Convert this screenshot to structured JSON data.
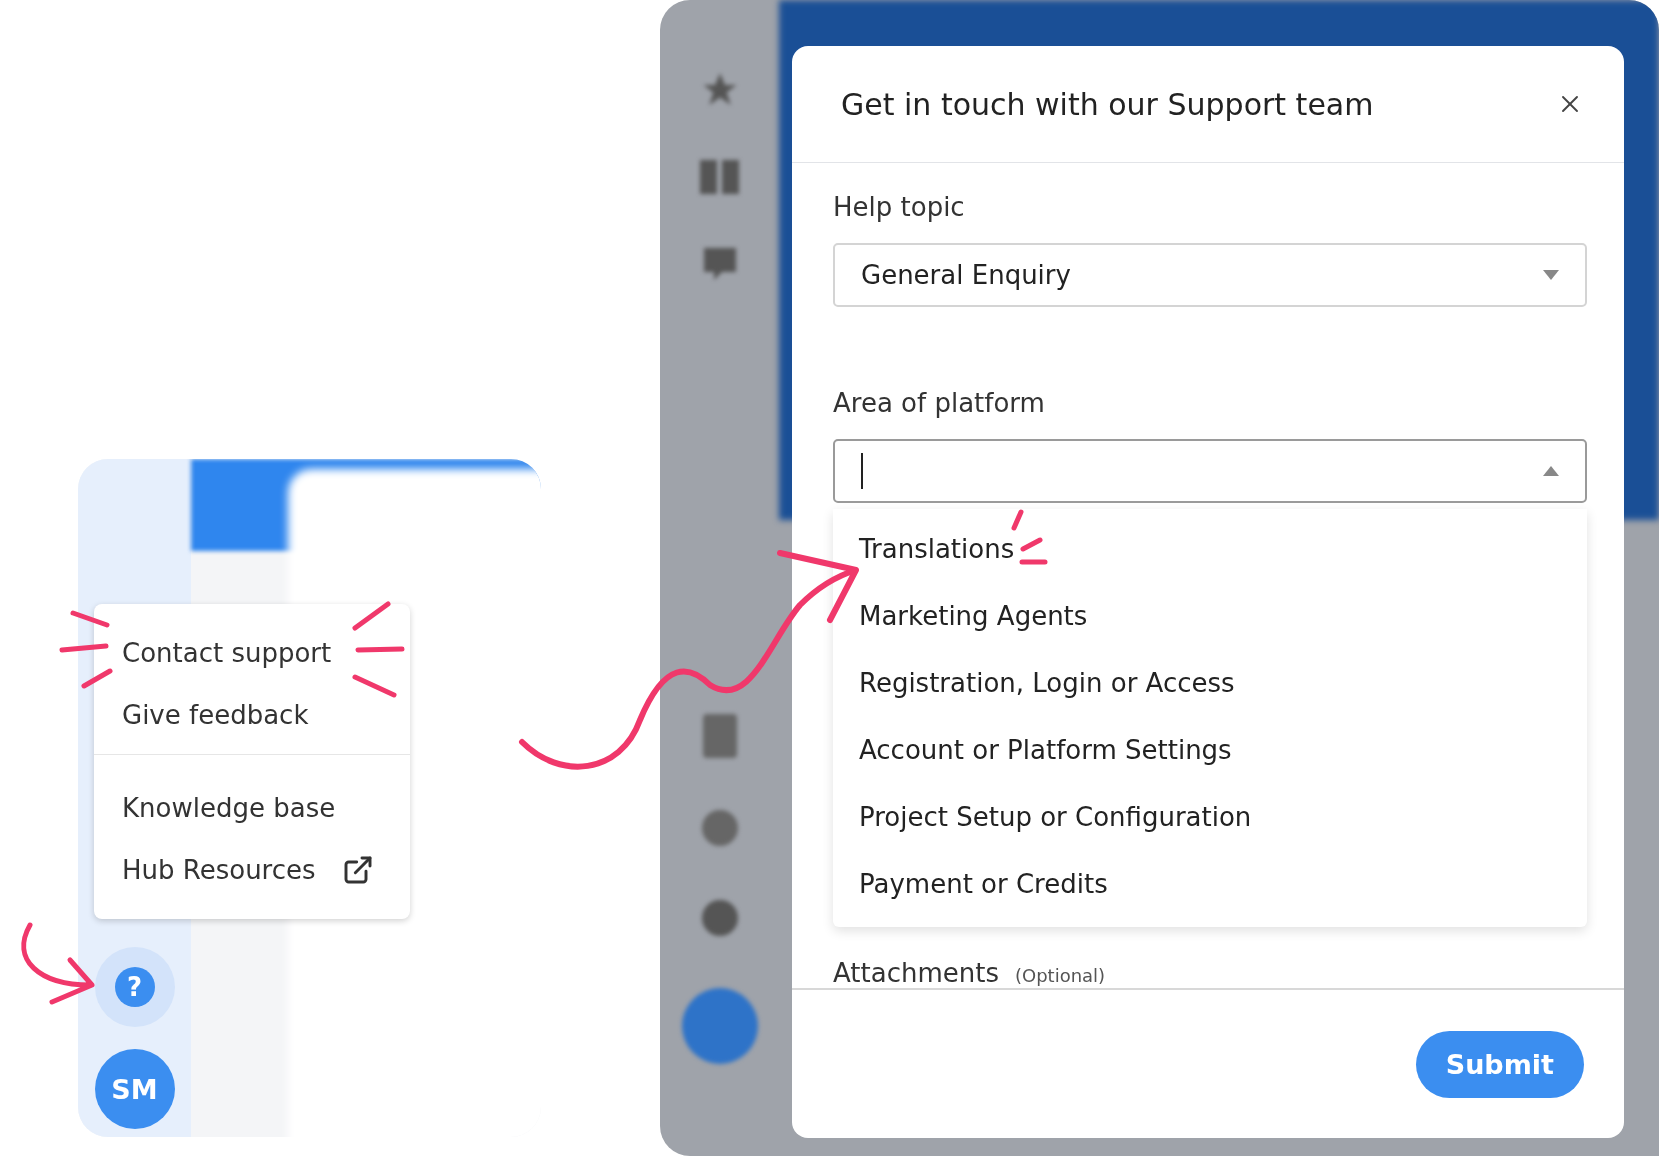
{
  "left_panel": {
    "menu": {
      "sections": [
        [
          {
            "label": "Contact support",
            "external": false
          },
          {
            "label": "Give feedback",
            "external": false
          }
        ],
        [
          {
            "label": "Knowledge base",
            "external": false
          },
          {
            "label": "Hub Resources",
            "external": true
          }
        ]
      ]
    },
    "help_button": {
      "icon": "?"
    },
    "avatar": {
      "initials": "SM"
    }
  },
  "support_dialog": {
    "title": "Get in touch with our Support team",
    "fields": [
      {
        "label": "Help topic",
        "value": "General Enquiry",
        "open": false
      },
      {
        "label": "Area of platform",
        "open": true,
        "options": [
          "Translations",
          "Marketing Agents",
          "Registration, Login or Access",
          "Account or Platform Settings",
          "Project Setup or Configuration",
          "Payment or Credits"
        ]
      }
    ],
    "attachments": {
      "label": "Attachments",
      "note": "(Optional)"
    },
    "submit": "Submit"
  }
}
